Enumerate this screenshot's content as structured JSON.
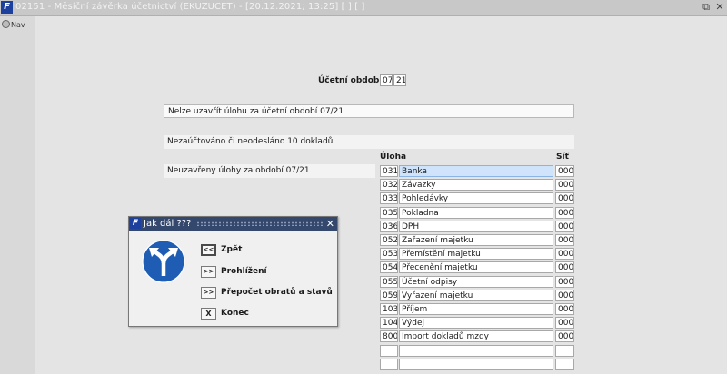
{
  "window": {
    "icon_glyph": "F",
    "title": "02151 - Měsíční závěrka účetnictví (EKUZUCET) - [20.12.2021; 13:25] [ ] [ ]",
    "restore_glyph": "⧉",
    "close_glyph": "✕"
  },
  "sidebar": {
    "nav_label": "Nav",
    "nav_icon": "compass-icon"
  },
  "period": {
    "label": "Účetní období",
    "month": "07",
    "year": "21"
  },
  "messages": {
    "cannot_close": "Nelze uzavřít úlohu za účetní období 07/21",
    "unposted": "Nezaúčtováno či neodesláno 10 dokladů",
    "unclosed_tasks": "Neuzavřeny úlohy za období 07/21"
  },
  "grid": {
    "header_task": "Úloha",
    "header_net": "Síť",
    "selected_index": 0,
    "rows": [
      {
        "code": "031",
        "name": "Banka",
        "net": "000"
      },
      {
        "code": "032",
        "name": "Závazky",
        "net": "000"
      },
      {
        "code": "033",
        "name": "Pohledávky",
        "net": "000"
      },
      {
        "code": "035",
        "name": "Pokladna",
        "net": "000"
      },
      {
        "code": "036",
        "name": "DPH",
        "net": "000"
      },
      {
        "code": "052",
        "name": "Zařazení majetku",
        "net": "000"
      },
      {
        "code": "053",
        "name": "Přemístění majetku",
        "net": "000"
      },
      {
        "code": "054",
        "name": "Přecenění majetku",
        "net": "000"
      },
      {
        "code": "055",
        "name": "Účetní odpisy",
        "net": "000"
      },
      {
        "code": "059",
        "name": "Vyřazení majetku",
        "net": "000"
      },
      {
        "code": "103",
        "name": "Příjem",
        "net": "000"
      },
      {
        "code": "104",
        "name": "Výdej",
        "net": "000"
      },
      {
        "code": "800",
        "name": "Import dokladů mzdy",
        "net": "000"
      },
      {
        "code": "",
        "name": "",
        "net": ""
      },
      {
        "code": "",
        "name": "",
        "net": ""
      }
    ]
  },
  "dialog": {
    "title": "Jak dál ???",
    "icon_glyph": "F",
    "close_glyph": "✕",
    "sign_icon": "direction-fork-sign-icon",
    "colors": {
      "sign_fill": "#1f5db5",
      "titlebar": "#34486d",
      "selected_row": "#cfe4fb"
    },
    "actions": [
      {
        "glyph": "<<",
        "label": "Zpět"
      },
      {
        "glyph": ">>",
        "label": "Prohlížení"
      },
      {
        "glyph": ">>",
        "label": "Přepočet obratů a stavů"
      },
      {
        "glyph": "X",
        "label": "Konec"
      }
    ]
  }
}
